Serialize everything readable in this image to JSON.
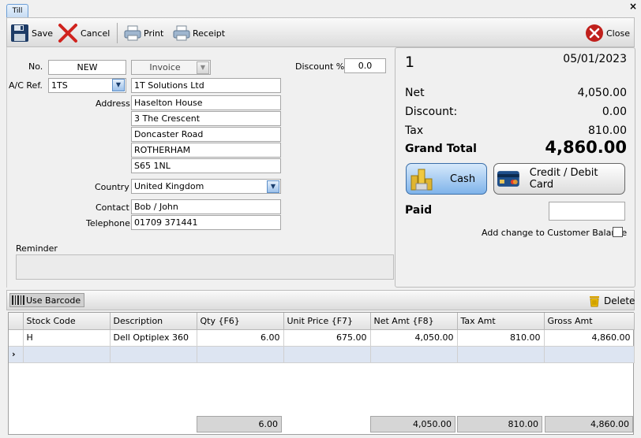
{
  "window": {
    "tab_label": "Till",
    "close_glyph": "×"
  },
  "toolbar": {
    "save": "Save",
    "cancel": "Cancel",
    "print": "Print",
    "receipt": "Receipt",
    "close": "Close"
  },
  "form": {
    "no_label": "No.",
    "no_value": "NEW",
    "doc_type": "Invoice",
    "discount_label": "Discount %",
    "discount_value": "0.0",
    "acref_label": "A/C Ref.",
    "acref_value": "1TS",
    "company": "1T Solutions Ltd",
    "address_label": "Address",
    "address": [
      "Haselton House",
      "3 The Crescent",
      "Doncaster Road",
      "ROTHERHAM",
      "S65 1NL"
    ],
    "country_label": "Country",
    "country_value": "United Kingdom",
    "contact_label": "Contact",
    "contact_value": "Bob / John",
    "telephone_label": "Telephone",
    "telephone_value": "01709 371441",
    "reminder_label": "Reminder",
    "reminder_value": ""
  },
  "totals": {
    "number": "1",
    "date": "05/01/2023",
    "net_label": "Net",
    "net_value": "4,050.00",
    "discount_label": "Discount:",
    "discount_value": "0.00",
    "tax_label": "Tax",
    "tax_value": "810.00",
    "grand_label": "Grand Total",
    "grand_value": "4,860.00",
    "cash_label": "Cash",
    "card_label": "Credit / Debit Card",
    "paid_label": "Paid",
    "paid_value": "",
    "change_label": "Add change to Customer Balance"
  },
  "grid_toolbar": {
    "barcode_label": "Use Barcode",
    "delete_label": "Delete"
  },
  "grid": {
    "columns": [
      "Stock Code",
      "Description",
      "Qty {F6}",
      "Unit Price {F7}",
      "Net Amt {F8}",
      "Tax Amt",
      "Gross Amt"
    ],
    "rows": [
      [
        "H",
        "Dell Optiplex 360",
        "6.00",
        "675.00",
        "4,050.00",
        "810.00",
        "4,860.00"
      ]
    ],
    "new_row_marker": "›",
    "footer": {
      "qty": "6.00",
      "net": "4,050.00",
      "tax": "810.00",
      "gross": "4,860.00"
    }
  }
}
